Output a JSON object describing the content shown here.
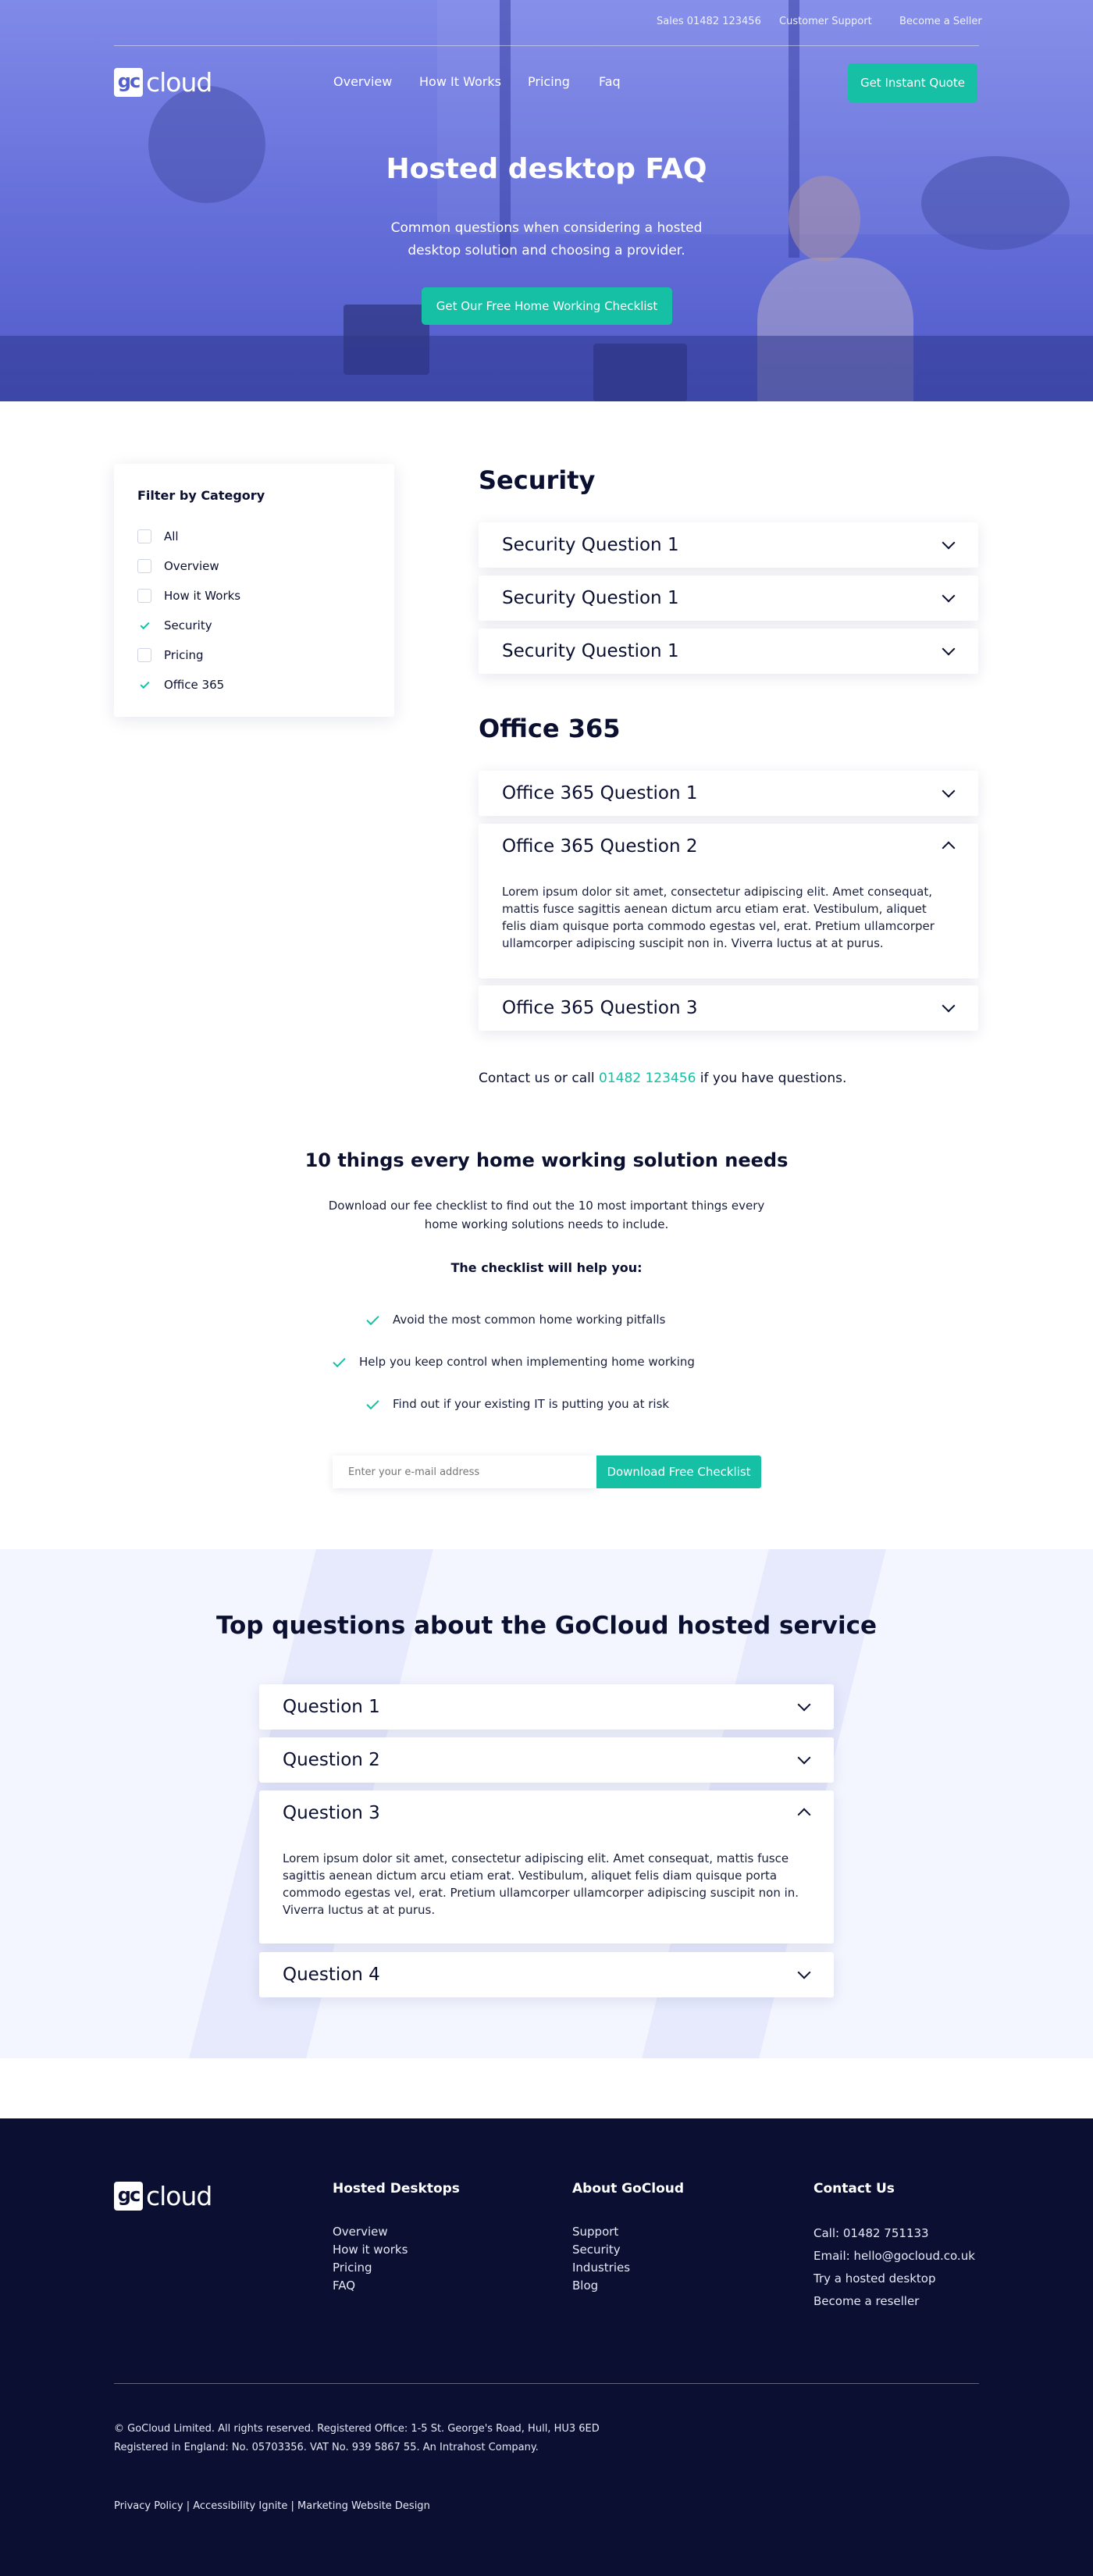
{
  "colors": {
    "accent": "#15c0a4",
    "hero_overlay": "#6b74d8",
    "footer_bg": "#0b1033",
    "faq_bg": "#f3f5ff"
  },
  "topbar": {
    "sales": "Sales 01482 123456",
    "support": "Customer Support",
    "seller": "Become a Seller"
  },
  "brand": {
    "mark": "gc",
    "word": "cloud"
  },
  "nav": {
    "items": [
      "Overview",
      "How It Works",
      "Pricing",
      "Faq"
    ],
    "cta": "Get Instant Quote"
  },
  "hero": {
    "title": "Hosted desktop FAQ",
    "subtitle": "Common questions when considering a hosted desktop solution and choosing a provider.",
    "cta": "Get Our Free Home Working Checklist"
  },
  "filter": {
    "title": "Filter by Category",
    "items": [
      {
        "label": "All",
        "checked": false
      },
      {
        "label": "Overview",
        "checked": false
      },
      {
        "label": "How it Works",
        "checked": false
      },
      {
        "label": "Security",
        "checked": true
      },
      {
        "label": "Pricing",
        "checked": false
      },
      {
        "label": "Office 365",
        "checked": true
      }
    ]
  },
  "security": {
    "heading": "Security",
    "questions": [
      "Security Question 1",
      "Security Question 1",
      "Security Question 1"
    ]
  },
  "office": {
    "heading": "Office 365",
    "q1": "Office 365 Question 1",
    "q2": "Office 365 Question 2",
    "q2_answer": "Lorem ipsum dolor sit amet, consectetur adipiscing elit. Amet consequat, mattis fusce sagittis aenean dictum arcu etiam erat. Vestibulum, aliquet felis diam quisque porta commodo egestas vel, erat. Pretium ullamcorper ullamcorper adipiscing suscipit non in. Viverra luctus at at purus.",
    "q3": "Office 365 Question 3"
  },
  "contact": {
    "prefix": "Contact us or call ",
    "phone": "01482 123456",
    "suffix": " if you have questions."
  },
  "checklist": {
    "title": "10 things every home working solution needs",
    "body": "Download our fee checklist to find out the 10 most important things every home working solutions needs to include.",
    "subtitle": "The checklist will help you:",
    "items": [
      "Avoid the most common home working pitfalls",
      "Help you keep control when implementing home working",
      "Find out if your existing IT is putting you at risk"
    ],
    "email_placeholder": "Enter your e-mail address",
    "button": "Download Free Checklist"
  },
  "top_questions": {
    "title": "Top questions about the GoCloud hosted service",
    "q1": "Question 1",
    "q2": "Question 2",
    "q3": "Question 3",
    "q3_answer": "Lorem ipsum dolor sit amet, consectetur adipiscing elit. Amet consequat, mattis fusce sagittis aenean dictum arcu etiam erat. Vestibulum, aliquet felis diam quisque porta commodo egestas vel, erat. Pretium ullamcorper ullamcorper adipiscing suscipit non in. Viverra luctus at at purus.",
    "q4": "Question 4"
  },
  "footer": {
    "col1": {
      "heading": "Hosted Desktops",
      "links": [
        "Overview",
        "How it works",
        "Pricing",
        "FAQ"
      ]
    },
    "col2": {
      "heading": "About GoCloud",
      "links": [
        "Support",
        "Security",
        "Industries",
        "Blog"
      ]
    },
    "col3": {
      "heading": "Contact Us",
      "links": [
        "Call: 01482 751133",
        "Email: hello@gocloud.co.uk",
        "Try a hosted desktop",
        "Become a reseller"
      ]
    },
    "legal1": "© GoCloud Limited. All rights reserved. Registered Office: 1-5 St. George's Road, Hull, HU3 6ED",
    "legal2": "Registered in England: No. 05703356. VAT No. 939 5867 55. An Intrahost Company.",
    "bottom": "Privacy Policy | Accessibility Ignite | Marketing Website Design"
  }
}
